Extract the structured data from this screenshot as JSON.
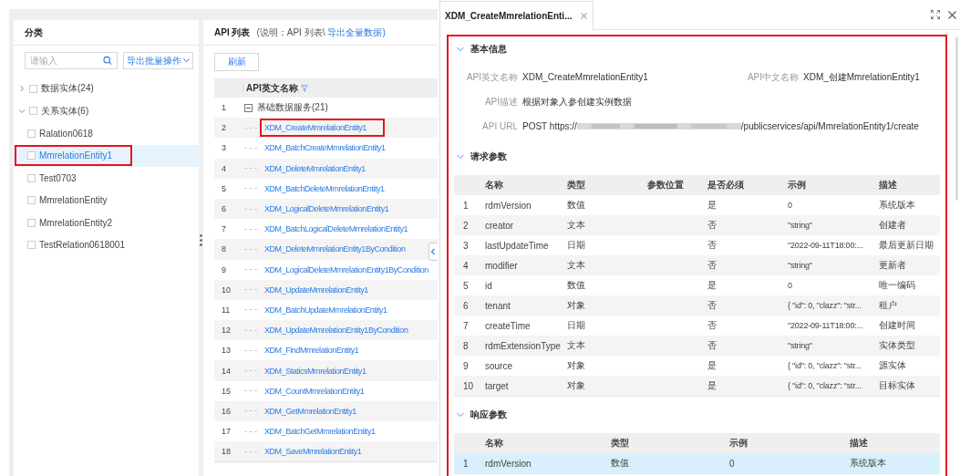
{
  "category_panel": {
    "title": "分类",
    "search": {
      "placeholder": "请输入"
    },
    "export_button": "导出批量操作",
    "tree": [
      {
        "label": "数据实体(24)",
        "expanded": false,
        "checked": false,
        "selected": false
      },
      {
        "label": "关系实体(6)",
        "expanded": true,
        "checked": false,
        "selected": false,
        "children": [
          {
            "label": "Ralation0618",
            "checked": false,
            "selected": false,
            "highlighted": false
          },
          {
            "label": "MmrelationEntity1",
            "checked": false,
            "selected": true,
            "highlighted": true
          },
          {
            "label": "Test0703",
            "checked": false,
            "selected": false,
            "highlighted": false
          },
          {
            "label": "MmrelationEntity",
            "checked": false,
            "selected": false,
            "highlighted": false
          },
          {
            "label": "MmrelationEntity2",
            "checked": false,
            "selected": false,
            "highlighted": false
          },
          {
            "label": "TestRelation0618001",
            "checked": false,
            "selected": false,
            "highlighted": false
          }
        ]
      }
    ]
  },
  "api_panel": {
    "title": "API 列表",
    "note": "(说明：API 列表\\",
    "export_link": "导出全量数据)",
    "refresh_button": "刷新",
    "column": "API英文名称",
    "rows": [
      {
        "index": "1",
        "kind": "group",
        "name": "基础数据服务(21)"
      },
      {
        "index": "2",
        "kind": "api",
        "name": "XDM_CreateMmrelationEntity1",
        "highlighted": true
      },
      {
        "index": "3",
        "kind": "api",
        "name": "XDM_BatchCreateMmrelationEntity1",
        "highlighted": false
      },
      {
        "index": "4",
        "kind": "api",
        "name": "XDM_DeleteMmrelationEntity1",
        "highlighted": false
      },
      {
        "index": "5",
        "kind": "api",
        "name": "XDM_BatchDeleteMmrelationEntity1",
        "highlighted": false
      },
      {
        "index": "6",
        "kind": "api",
        "name": "XDM_LogicalDeleteMmrelationEntity1",
        "highlighted": false
      },
      {
        "index": "7",
        "kind": "api",
        "name": "XDM_BatchLogicalDeleteMmrelationEntity1",
        "highlighted": false
      },
      {
        "index": "8",
        "kind": "api",
        "name": "XDM_DeleteMmrelationEntity1ByCondition",
        "highlighted": false
      },
      {
        "index": "9",
        "kind": "api",
        "name": "XDM_LogicalDeleteMmrelationEntity1ByCondition",
        "highlighted": false
      },
      {
        "index": "10",
        "kind": "api",
        "name": "XDM_UpdateMmrelationEntity1",
        "highlighted": false
      },
      {
        "index": "11",
        "kind": "api",
        "name": "XDM_BatchUpdateMmrelationEntity1",
        "highlighted": false
      },
      {
        "index": "12",
        "kind": "api",
        "name": "XDM_UpdateMmrelationEntity1ByCondition",
        "highlighted": false
      },
      {
        "index": "13",
        "kind": "api",
        "name": "XDM_FindMmrelationEntity1",
        "highlighted": false
      },
      {
        "index": "14",
        "kind": "api",
        "name": "XDM_StaticsMmrelationEntity1",
        "highlighted": false
      },
      {
        "index": "15",
        "kind": "api",
        "name": "XDM_CountMmrelationEntity1",
        "highlighted": false
      },
      {
        "index": "16",
        "kind": "api",
        "name": "XDM_GetMmrelationEntity1",
        "highlighted": false
      },
      {
        "index": "17",
        "kind": "api",
        "name": "XDM_BatchGetMmrelationEntity1",
        "highlighted": false
      },
      {
        "index": "18",
        "kind": "api",
        "name": "XDM_SaveMmrelationEntity1",
        "highlighted": false
      }
    ]
  },
  "detail_panel": {
    "tab": "XDM_CreateMmrelationEnti...",
    "highlighted": true,
    "basic_info": {
      "title": "基本信息",
      "expanded": true,
      "en_name_label": "API英文名称",
      "en_name": "XDM_CreateMmrelationEntity1",
      "cn_name_label": "API中文名称",
      "cn_name": "XDM_创建MmrelationEntity1",
      "desc_label": "API描述",
      "desc": "根据对象入参创建实例数据",
      "url_label": "API URL",
      "url_prefix": "POST https://",
      "url_suffix": "/publicservices/api/MmrelationEntity1/create"
    },
    "request_params": {
      "title": "请求参数",
      "expanded": true,
      "columns": [
        "",
        "名称",
        "类型",
        "参数位置",
        "是否必须",
        "示例",
        "描述"
      ],
      "rows": [
        [
          "1",
          "rdmVersion",
          "数值",
          "",
          "是",
          "0",
          "系统版本"
        ],
        [
          "2",
          "creator",
          "文本",
          "",
          "否",
          "\"string\"",
          "创建者"
        ],
        [
          "3",
          "lastUpdateTime",
          "日期",
          "",
          "否",
          "\"2022-09-11T18:00:...",
          "最后更新日期"
        ],
        [
          "4",
          "modifier",
          "文本",
          "",
          "否",
          "\"string\"",
          "更新者"
        ],
        [
          "5",
          "id",
          "数值",
          "",
          "是",
          "0",
          "唯一编码"
        ],
        [
          "6",
          "tenant",
          "对象",
          "",
          "否",
          "{ \"id\": 0, \"clazz\": \"str...",
          "租户"
        ],
        [
          "7",
          "createTime",
          "日期",
          "",
          "否",
          "\"2022-09-11T18:00:...",
          "创建时间"
        ],
        [
          "8",
          "rdmExtensionType",
          "文本",
          "",
          "否",
          "\"string\"",
          "实体类型"
        ],
        [
          "9",
          "source",
          "对象",
          "",
          "是",
          "{ \"id\": 0, \"clazz\": \"str...",
          "源实体"
        ],
        [
          "10",
          "target",
          "对象",
          "",
          "是",
          "{ \"id\": 0, \"clazz\": \"str...",
          "目标实体"
        ]
      ]
    },
    "response_params": {
      "title": "响应参数",
      "expanded": true,
      "columns": [
        "",
        "名称",
        "类型",
        "示例",
        "描述"
      ],
      "rows": [
        {
          "cells": [
            "1",
            "rdmVersion",
            "数值",
            "0",
            "系统版本"
          ],
          "selected": true
        }
      ]
    }
  }
}
